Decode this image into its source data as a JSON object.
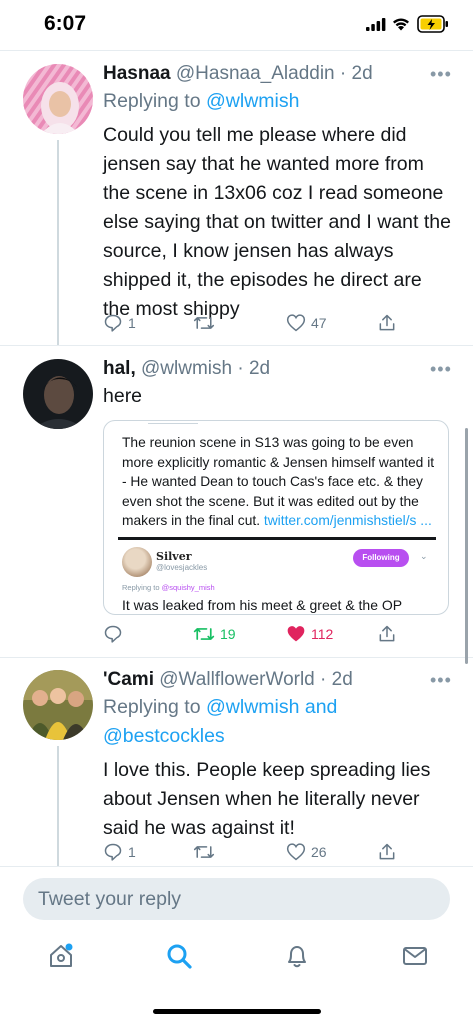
{
  "status_bar": {
    "time": "6:07"
  },
  "tweets": [
    {
      "name": "Hasnaa",
      "handle_time": "@Hasnaa_Aladdin · 2d",
      "reply_prefix": "Replying to ",
      "reply_mentions": "@wlwmish",
      "text": "Could you tell me please where did jensen say that he wanted more from the scene in 13x06 coz I read someone else saying that on twitter and I want the source, I know jensen has always shipped it, the episodes he direct are the most shippy",
      "reply_count": "1",
      "retweet_count": "",
      "like_count": "47"
    },
    {
      "name": "hal,",
      "handle_time": "@wlwmish · 2d",
      "text": "here",
      "embed": {
        "quote_text": "The reunion scene in S13 was going to be even more explicitly romantic & Jensen himself wanted it - He wanted Dean to touch Cas's face etc. & they even shot the scene. But it was edited out by the makers in the final cut. ",
        "quote_link": "twitter.com/jenmishstiel/s ...",
        "mini_name": "Silver",
        "mini_handle": "@lovesjackles",
        "follow_label": "Following",
        "mini_reply_prefix": "Replying to ",
        "mini_reply_mention": "@squishy_mish",
        "mini_body": "It was leaked from his meet & greet & the OP"
      },
      "reply_count": "",
      "retweet_count": "19",
      "like_count": "112"
    },
    {
      "name": "'Cami",
      "handle_time": "@WallflowerWorld · 2d",
      "reply_prefix": "Replying to ",
      "reply_mentions_1": "@wlwmish and",
      "reply_mentions_2": "@bestcockles",
      "text": "I love this. People keep spreading lies about Jensen when he literally never said he was against it!",
      "reply_count": "1",
      "retweet_count": "",
      "like_count": "26"
    }
  ],
  "compose": {
    "placeholder": "Tweet your reply"
  },
  "tabbar": [
    "home-icon",
    "search-icon",
    "notifications-icon",
    "messages-icon"
  ],
  "colors": {
    "accent": "#1da1f2",
    "retweet_active": "#17bf63",
    "like_active": "#e0245e",
    "muted": "#657786"
  }
}
